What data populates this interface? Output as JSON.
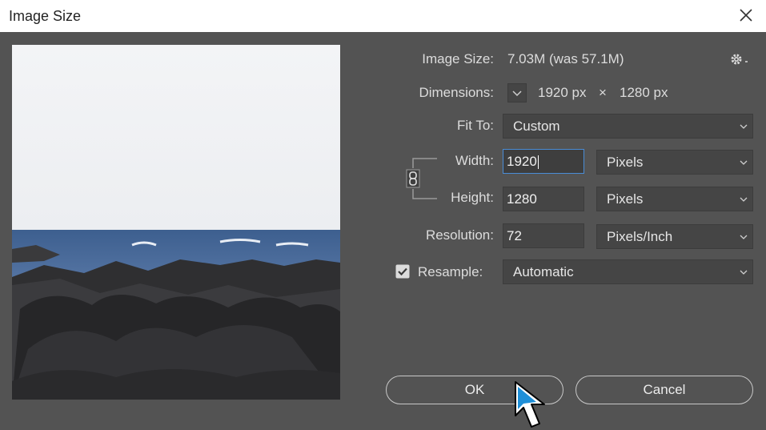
{
  "window": {
    "title": "Image Size"
  },
  "info": {
    "image_size_label": "Image Size:",
    "image_size_value": "7.03M (was 57.1M)",
    "dimensions_label": "Dimensions:",
    "dim_width": "1920 px",
    "dim_times": "×",
    "dim_height": "1280 px"
  },
  "fit_to": {
    "label": "Fit To:",
    "value": "Custom"
  },
  "width": {
    "label": "Width:",
    "value": "1920",
    "unit": "Pixels"
  },
  "height": {
    "label": "Height:",
    "value": "1280",
    "unit": "Pixels"
  },
  "resolution": {
    "label": "Resolution:",
    "value": "72",
    "unit": "Pixels/Inch"
  },
  "resample": {
    "label": "Resample:",
    "checked": true,
    "value": "Automatic"
  },
  "buttons": {
    "ok": "OK",
    "cancel": "Cancel"
  },
  "colors": {
    "dialog_bg": "#535353",
    "field_bg": "#454545",
    "focus_border": "#4a8cd6"
  }
}
